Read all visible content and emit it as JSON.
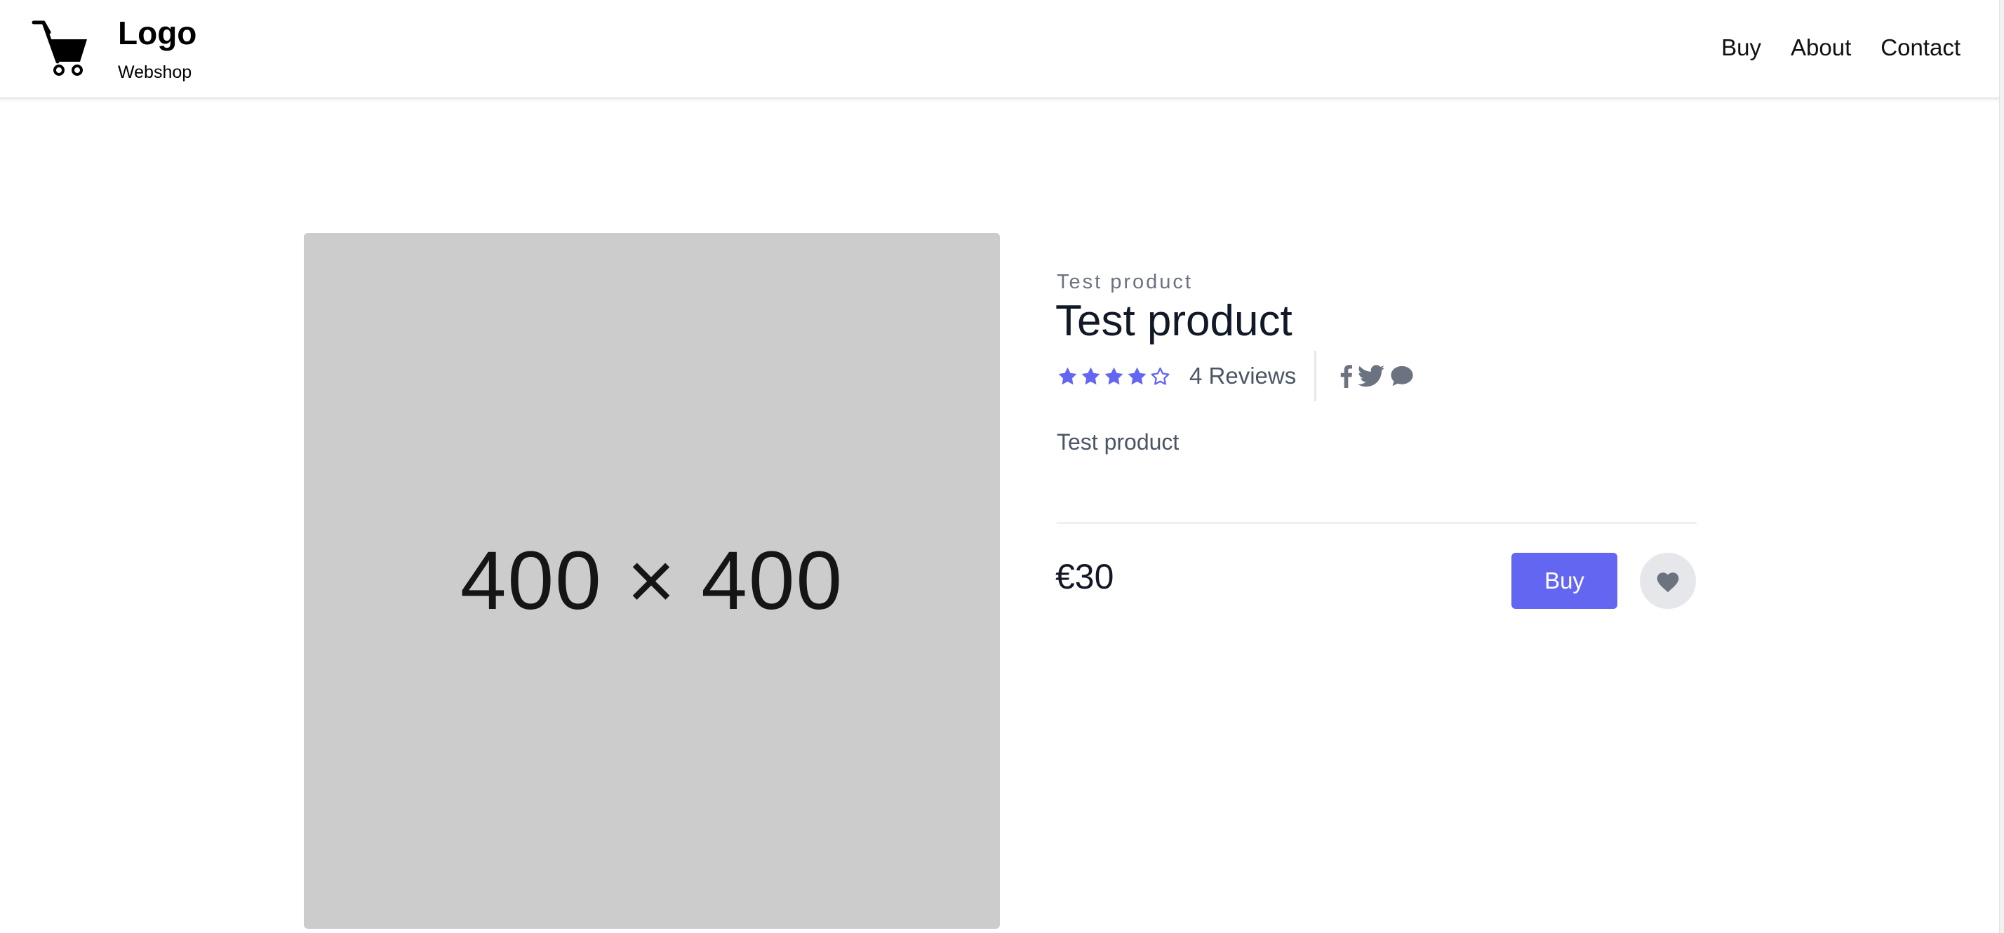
{
  "header": {
    "logo_title": "Logo",
    "logo_subtitle": "Webshop",
    "logo_icon": "shopping-cart-icon",
    "nav": [
      {
        "label": "Buy"
      },
      {
        "label": "About"
      },
      {
        "label": "Contact"
      }
    ]
  },
  "product": {
    "image_placeholder": "400 × 400",
    "brand": "Test product",
    "title": "Test product",
    "rating": {
      "value": 4,
      "max": 5
    },
    "reviews_label": "4 Reviews",
    "social_icons": [
      "facebook-icon",
      "twitter-icon",
      "chat-icon"
    ],
    "description": "Test product",
    "price": "€30",
    "buy_label": "Buy",
    "favorite_icon": "heart-icon"
  },
  "colors": {
    "accent": "#6366f1",
    "image_bg": "#cccccc",
    "muted_text": "#6b7280",
    "icon_gray": "#6b7280"
  }
}
